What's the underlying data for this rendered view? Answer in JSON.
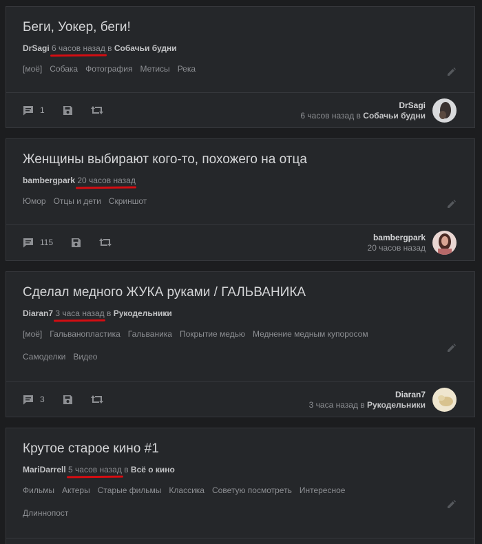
{
  "posts": [
    {
      "title": "Беги, Уокер, беги!",
      "author": "DrSagi",
      "time": "6 часов назад",
      "in_word": "в",
      "community": "Собачьи будни",
      "tag_rows": [
        [
          "[моё]",
          "Собака",
          "Фотография",
          "Метисы",
          "Река"
        ]
      ],
      "comments": "1",
      "footer_time": "6 часов назад в",
      "avatar_color": "#6b6f73"
    },
    {
      "title": "Женщины выбирают кого-то, похожего на отца",
      "author": "bambergpark",
      "time": "20 часов назад",
      "in_word": "",
      "community": "",
      "tag_rows": [
        [
          "Юмор",
          "Отцы и дети",
          "Скриншот"
        ]
      ],
      "comments": "115",
      "footer_time": "20 часов назад",
      "avatar_color": "#c79a8e"
    },
    {
      "title": "Сделал медного ЖУКА руками / ГАЛЬВАНИКА",
      "author": "Diaran7",
      "time": "3 часа назад",
      "in_word": "в",
      "community": "Рукодельники",
      "tag_rows": [
        [
          "[моё]",
          "Гальванопластика",
          "Гальваника",
          "Покрытие медью",
          "Меднение медным купоросом"
        ],
        [
          "Самоделки",
          "Видео"
        ]
      ],
      "comments": "3",
      "footer_time": "3 часа назад в",
      "avatar_color": "#d8c9a0"
    },
    {
      "title": "Крутое старое кино #1",
      "author": "MariDarrell",
      "time": "5 часов назад",
      "in_word": "в",
      "community": "Всё о кино",
      "tag_rows": [
        [
          "Фильмы",
          "Актеры",
          "Старые фильмы",
          "Классика",
          "Советую посмотреть",
          "Интересное"
        ],
        [
          "Длиннопост"
        ]
      ]
    }
  ],
  "colors": {
    "background": "#1c1d1f",
    "card": "#25272a",
    "underline": "#d40d12"
  },
  "icons": {
    "comments": "comment-icon",
    "save": "save-icon",
    "share": "repost-icon",
    "edit": "pencil-icon"
  }
}
